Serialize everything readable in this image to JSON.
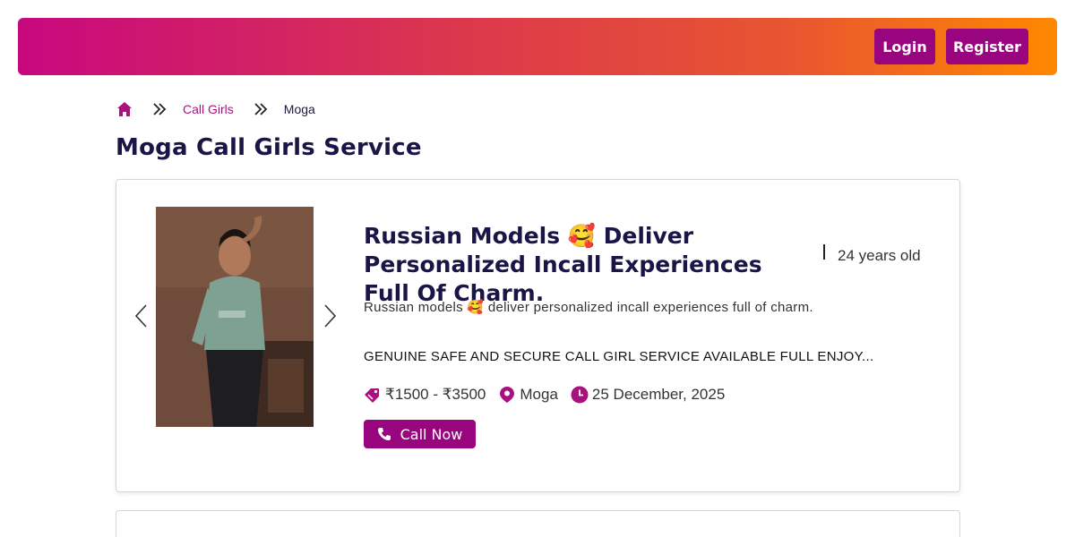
{
  "header": {
    "login_label": "Login",
    "register_label": "Register",
    "gradient_colors": [
      "#c8087f",
      "#dc3a4a",
      "#e9562f",
      "#ff8800"
    ],
    "button_color": "#99057f"
  },
  "breadcrumb": {
    "home_icon": "home-icon",
    "items": [
      {
        "label": "Call Girls"
      },
      {
        "label": "Moga"
      }
    ]
  },
  "page_title": "Moga Call Girls Service",
  "listing": {
    "title": "Russian Models 🥰 Deliver Personalized Incall Experiences Full Of Charm.",
    "age": "24 years old",
    "description": "Russian models 🥰 deliver personalized incall experiences full of charm.",
    "highlight": "GENUINE SAFE AND SECURE CALL GIRL SERVICE AVAILABLE FULL ENJOY...",
    "price": "₹1500 - ₹3500",
    "location": "Moga",
    "date": "25 December, 2025",
    "call_label": "Call Now",
    "accent_color": "#a8127d"
  }
}
